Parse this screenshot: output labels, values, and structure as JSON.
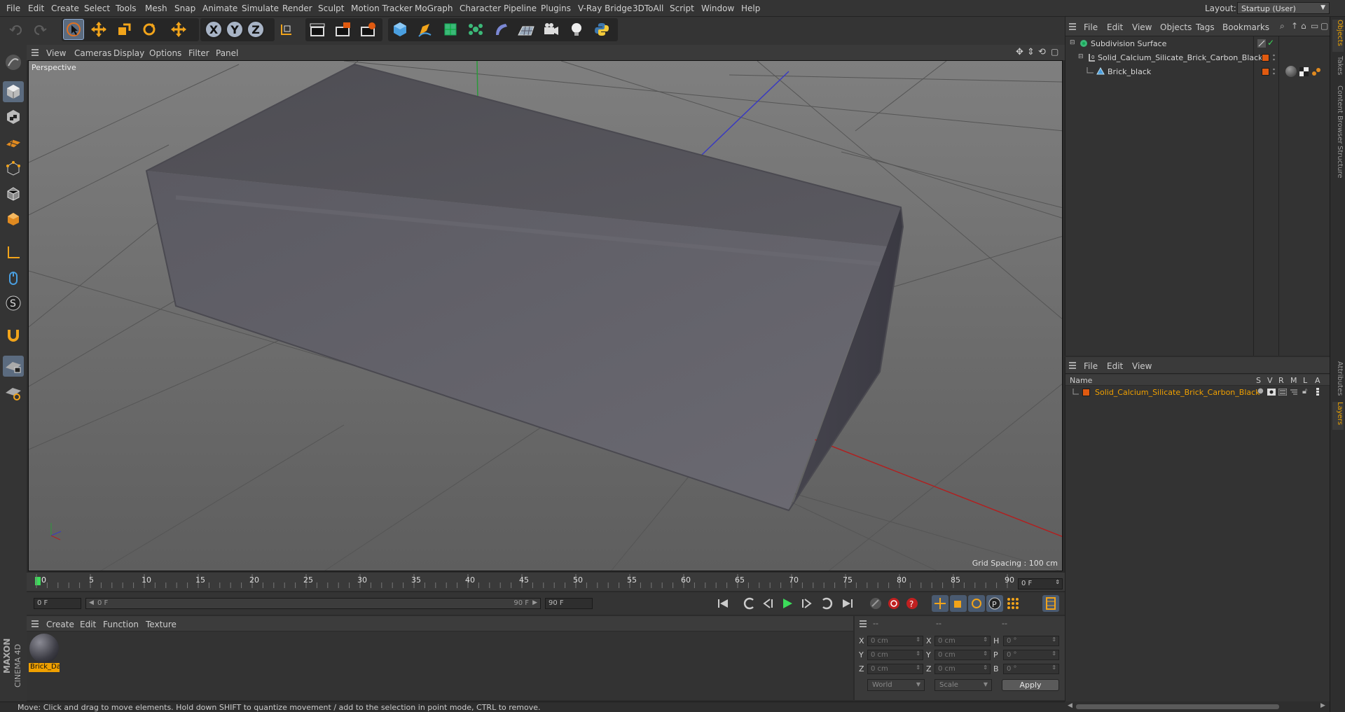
{
  "menubar": {
    "items": [
      "File",
      "Edit",
      "Create",
      "Select",
      "Tools",
      "Mesh",
      "Snap",
      "Animate",
      "Simulate",
      "Render",
      "Sculpt",
      "Motion Tracker",
      "MoGraph",
      "Character",
      "Pipeline",
      "Plugins",
      "V-Ray Bridge",
      "3DToAll",
      "Script",
      "Window",
      "Help"
    ],
    "layout_label": "Layout:",
    "layout_value": "Startup (User)"
  },
  "toolbar": {
    "axis_x": "X",
    "axis_y": "Y",
    "axis_z": "Z"
  },
  "viewport": {
    "menu": [
      "View",
      "Cameras",
      "Display",
      "Options",
      "Filter",
      "Panel"
    ],
    "title": "Perspective",
    "grid_spacing": "Grid Spacing : 100 cm",
    "object_color": "#5b5a61",
    "floor_color": "#6a6a6a"
  },
  "timeline": {
    "ticks": [
      "0",
      "5",
      "10",
      "15",
      "20",
      "25",
      "30",
      "35",
      "40",
      "45",
      "50",
      "55",
      "60",
      "65",
      "70",
      "75",
      "80",
      "85",
      "90"
    ],
    "frame": "0 F",
    "current_frame": "0 F",
    "range_start": "0 F",
    "range_end_label": "90 F",
    "end_frame": "90 F"
  },
  "materials": {
    "menu": [
      "Create",
      "Edit",
      "Function",
      "Texture"
    ],
    "items": [
      {
        "name": "Brick_Da"
      }
    ]
  },
  "coords": {
    "header": [
      "--",
      "--",
      "--"
    ],
    "rows": [
      {
        "l1": "X",
        "v1": "0 cm",
        "l2": "X",
        "v2": "0 cm",
        "l3": "H",
        "v3": "0 °"
      },
      {
        "l1": "Y",
        "v1": "0 cm",
        "l2": "Y",
        "v2": "0 cm",
        "l3": "P",
        "v3": "0 °"
      },
      {
        "l1": "Z",
        "v1": "0 cm",
        "l2": "Z",
        "v2": "0 cm",
        "l3": "B",
        "v3": "0 °"
      }
    ],
    "world": "World",
    "scale": "Scale",
    "apply": "Apply"
  },
  "status": {
    "text": "Move: Click and drag to move elements. Hold down SHIFT to quantize movement / add to the selection in point mode, CTRL to remove."
  },
  "objects": {
    "menu": [
      "File",
      "Edit",
      "View",
      "Objects",
      "Tags",
      "Bookmarks"
    ],
    "tree": [
      {
        "name": "Subdivision Surface"
      },
      {
        "name": "Solid_Calcium_Silicate_Brick_Carbon_Black"
      },
      {
        "name": "Brick_black"
      }
    ]
  },
  "layers": {
    "menu": [
      "File",
      "Edit",
      "View"
    ],
    "headers": {
      "name": "Name",
      "s": "S",
      "v": "V",
      "r": "R",
      "m": "M",
      "l": "L",
      "a": "A"
    },
    "rows": [
      {
        "name": "Solid_Calcium_Silicate_Brick_Carbon_Black",
        "color": "#f0a000"
      }
    ]
  },
  "side_tabs": [
    "Objects",
    "Takes",
    "Content Browser",
    "Structure",
    "Attributes",
    "Layers"
  ],
  "brand": {
    "line1": "MAXON",
    "line2": "CINEMA 4D"
  }
}
